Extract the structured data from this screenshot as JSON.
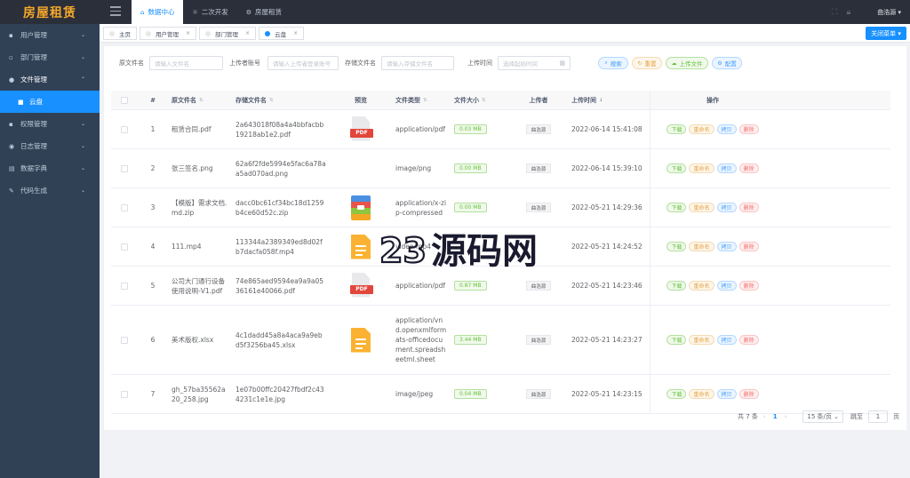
{
  "app": {
    "title": "房屋租赁"
  },
  "sidebar": {
    "items": [
      {
        "label": "用户管理",
        "icon": "user-icon"
      },
      {
        "label": "部门管理",
        "icon": "department-icon"
      },
      {
        "label": "文件管理",
        "icon": "file-icon"
      },
      {
        "label": "云盘",
        "icon": "folder-icon"
      },
      {
        "label": "权限管理",
        "icon": "lock-icon"
      },
      {
        "label": "日志管理",
        "icon": "log-icon"
      },
      {
        "label": "数据字典",
        "icon": "dictionary-icon"
      },
      {
        "label": "代码生成",
        "icon": "code-icon"
      }
    ]
  },
  "topbar": {
    "tabs": [
      {
        "label": "数据中心",
        "icon": "home-icon"
      },
      {
        "label": "二次开发",
        "icon": "sun-icon"
      },
      {
        "label": "房屋租赁",
        "icon": "gear-icon"
      }
    ],
    "user": "曲浩源"
  },
  "tags": [
    {
      "label": "主页"
    },
    {
      "label": "用户管理"
    },
    {
      "label": "部门管理"
    },
    {
      "label": "云盘"
    }
  ],
  "close_menu_label": "关闭菜单",
  "search": {
    "original_name_label": "原文件名",
    "original_name_placeholder": "请输入文件名",
    "uploader_label": "上传者账号",
    "uploader_placeholder": "请输入上传者登录账号",
    "stored_name_label": "存储文件名",
    "stored_name_placeholder": "请输入存储文件名",
    "upload_time_label": "上传时间",
    "upload_time_placeholder": "选择起始时间",
    "search_btn": "搜索",
    "reset_btn": "重置",
    "upload_btn": "上传文件",
    "config_btn": "配置"
  },
  "table": {
    "columns": [
      "#",
      "原文件名",
      "存储文件名",
      "预览",
      "文件类型",
      "文件大小",
      "上传者",
      "上传时间",
      "操作"
    ],
    "ops": {
      "download": "下载",
      "rename": "重命名",
      "copy": "拷贝",
      "delete": "删除"
    },
    "rows": [
      {
        "idx": "1",
        "name": "租赁合同.pdf",
        "store": "2a643018f08a4a4bbfacbb19218ab1e2.pdf",
        "preview": "pdf",
        "type": "application/pdf",
        "size": "0.03 MB",
        "uploader": "曲浩源",
        "time": "2022-06-14 15:41:08"
      },
      {
        "idx": "2",
        "name": "张三签名.png",
        "store": "62a6f2fde5994e5fac6a78aa5ad070ad.png",
        "preview": "",
        "type": "image/png",
        "size": "0.00 MB",
        "uploader": "曲浩源",
        "time": "2022-06-14 15:39:10"
      },
      {
        "idx": "3",
        "name": "【模版】需求文档.md.zip",
        "store": "dacc0bc61cf34bc18d1259b4ce60d52c.zip",
        "preview": "zip",
        "type": "application/x-zip-compressed",
        "size": "0.00 MB",
        "uploader": "曲浩源",
        "time": "2022-05-21 14:29:36"
      },
      {
        "idx": "4",
        "name": "111.mp4",
        "store": "113344a2389349ed8d02fb7dacfa058f.mp4",
        "preview": "doc",
        "type": "video/mp4",
        "size": "",
        "uploader": "",
        "time": "2022-05-21 14:24:52"
      },
      {
        "idx": "5",
        "name": "公司大门通行设备使用说明-V1.pdf",
        "store": "74e865aed9594ea9a9a0536161e40066.pdf",
        "preview": "pdf",
        "type": "application/pdf",
        "size": "0.87 MB",
        "uploader": "曲浩源",
        "time": "2022-05-21 14:23:46"
      },
      {
        "idx": "6",
        "name": "美术版权.xlsx",
        "store": "4c1dadd45a8a4aca9a9ebd5f3256ba45.xlsx",
        "preview": "doc",
        "type": "application/vnd.openxmlformats-officedocument.spreadsheetml.sheet",
        "size": "3.44 MB",
        "uploader": "曲浩源",
        "time": "2022-05-21 14:23:27"
      },
      {
        "idx": "7",
        "name": "gh_57ba35562a20_258.jpg",
        "store": "1e07b00ffc20427fbdf2c434231c1e1e.jpg",
        "preview": "",
        "type": "image/jpeg",
        "size": "0.04 MB",
        "uploader": "曲浩源",
        "time": "2022-05-21 14:23:15"
      }
    ]
  },
  "pager": {
    "total": "共 7 条",
    "current": "1",
    "page_size": "15 条/页",
    "jump_label": "跳至",
    "jump_value": "1",
    "page_suffix": "页"
  },
  "watermark": {
    "text": "源码网",
    "digits": "23"
  },
  "colors": {
    "primary": "#1890ff",
    "sidebar": "#304156",
    "logo": "#f7a82a"
  }
}
